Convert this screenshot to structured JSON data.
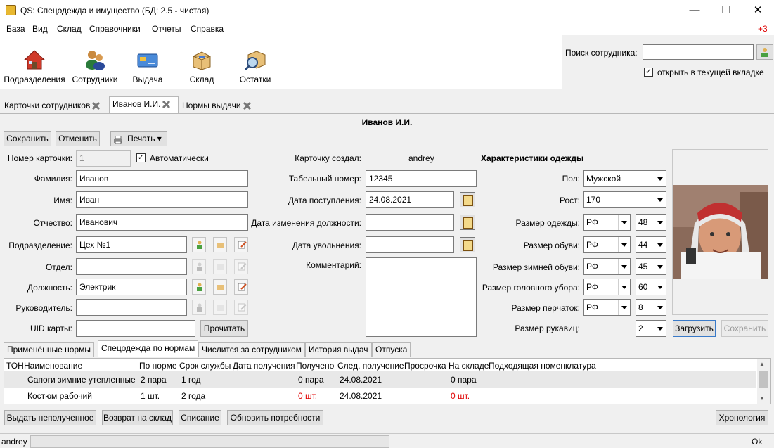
{
  "window": {
    "title": "QS: Спецодежда и имущество (БД: 2.5 - чистая)",
    "minimize": "—",
    "maximize": "☐",
    "close": "✕"
  },
  "menu": {
    "items": [
      "База",
      "Вид",
      "Склад",
      "Справочники",
      "Отчеты",
      "Справка"
    ],
    "badge": "+3"
  },
  "toolbar": {
    "buttons": [
      {
        "label": "Подразделения",
        "icon": "house-icon"
      },
      {
        "label": "Сотрудники",
        "icon": "employees-icon"
      },
      {
        "label": "Выдача",
        "icon": "issue-card-icon"
      },
      {
        "label": "Склад",
        "icon": "warehouse-box-icon"
      },
      {
        "label": "Остатки",
        "icon": "stock-search-icon"
      }
    ]
  },
  "search": {
    "label": "Поиск сотрудника:",
    "value": "",
    "open_current_tab_label": "открыть в текущей вкладке",
    "open_current_tab_checked": true
  },
  "doc_tabs": [
    {
      "label": "Карточки сотрудников",
      "closable": true
    },
    {
      "label": "Иванов И.И.",
      "closable": true,
      "active": true
    },
    {
      "label": "Нормы выдачи",
      "closable": true
    }
  ],
  "card": {
    "header": "Иванов И.И.",
    "actions": {
      "save": "Сохранить",
      "cancel": "Отменить",
      "print": "Печать ▾"
    },
    "card_number_label": "Номер карточки:",
    "card_number": "1",
    "auto_label": "Автоматически",
    "auto_checked": true,
    "last_name_label": "Фамилия:",
    "last_name": "Иванов",
    "first_name_label": "Имя:",
    "first_name": "Иван",
    "patronymic_label": "Отчество:",
    "patronymic": "Иванович",
    "subdivision_label": "Подразделение:",
    "subdivision": "Цех №1",
    "department_label": "Отдел:",
    "department": "",
    "position_label": "Должность:",
    "position": "Электрик",
    "manager_label": "Руководитель:",
    "manager": "",
    "uid_label": "UID карты:",
    "uid": "",
    "read_button": "Прочитать",
    "created_by_label": "Карточку создал:",
    "created_by": "andrey",
    "tab_number_label": "Табельный номер:",
    "tab_number": "12345",
    "hire_date_label": "Дата поступления:",
    "hire_date": "24.08.2021",
    "position_change_label": "Дата изменения должности:",
    "position_change": "",
    "dismissal_label": "Дата увольнения:",
    "dismissal": "",
    "comment_label": "Комментарий:",
    "comment": ""
  },
  "clothing": {
    "header": "Характеристики одежды",
    "gender_label": "Пол:",
    "gender": "Мужской",
    "height_label": "Рост:",
    "height": "170",
    "clothes_size_label": "Размер одежды:",
    "clothes_std": "РФ",
    "clothes_size": "48",
    "shoe_size_label": "Размер обуви:",
    "shoe_std": "РФ",
    "shoe_size": "44",
    "winter_shoe_label": "Размер зимней обуви:",
    "winter_shoe_std": "РФ",
    "winter_shoe_size": "45",
    "headwear_label": "Размер головного убора:",
    "headwear_std": "РФ",
    "headwear_size": "60",
    "gloves_label": "Размер перчаток:",
    "gloves_std": "РФ",
    "gloves_size": "8",
    "mittens_label": "Размер рукавиц:",
    "mittens_size": "2",
    "photo_load": "Загрузить",
    "photo_save": "Сохранить"
  },
  "subtabs": [
    "Применённые нормы",
    "Спецодежда по нормам",
    "Числится за сотрудником",
    "История выдач",
    "Отпуска"
  ],
  "table": {
    "columns": [
      "ТОН",
      "Наименование",
      "По норме",
      "Срок службы",
      "Дата получения",
      "Получено",
      "След. получение",
      "Просрочка",
      "На складе",
      "Подходящая номенклатура"
    ],
    "rows": [
      {
        "name": "Сапоги зимние утепленные",
        "norm": "2 пара",
        "term": "1 год",
        "received_date": "",
        "received": "0 пара",
        "next": "24.08.2021",
        "overdue": "",
        "stock": "0 пара",
        "nomenclature": ""
      },
      {
        "name": "Костюм рабочий",
        "norm": "1 шт.",
        "term": "2 года",
        "received_date": "",
        "received": "0 шт.",
        "next": "24.08.2021",
        "overdue": "",
        "stock": "0 шт.",
        "nomenclature": ""
      }
    ]
  },
  "bottom_actions": {
    "issue": "Выдать неполученное",
    "return": "Возврат на склад",
    "writeoff": "Списание",
    "update": "Обновить потребности",
    "chronology": "Хронология"
  },
  "status": {
    "user": "andrey",
    "state": "Ok"
  },
  "colors": {
    "accent_red": "#e00000",
    "row_selected": "#e8e8e8",
    "add_green": "#4aa040"
  }
}
